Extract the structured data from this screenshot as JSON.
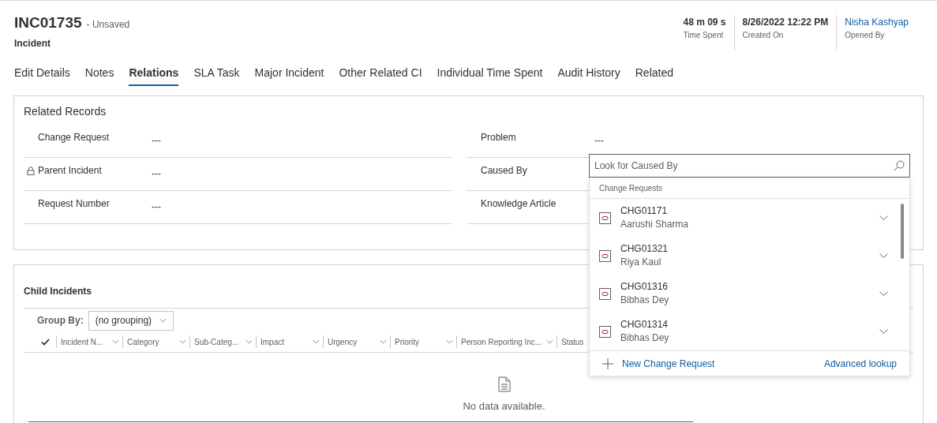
{
  "header": {
    "title": "INC01735",
    "save_status": "- Unsaved",
    "entity": "Incident",
    "stats": [
      {
        "value": "48 m 09 s",
        "label": "Time Spent",
        "kind": "text"
      },
      {
        "value": "8/26/2022 12:22 PM",
        "label": "Created On",
        "kind": "text"
      },
      {
        "value": "Nisha Kashyap",
        "label": "Opened By",
        "kind": "link"
      }
    ]
  },
  "tabs": [
    {
      "label": "Edit Details",
      "selected": false
    },
    {
      "label": "Notes",
      "selected": false
    },
    {
      "label": "Relations",
      "selected": true
    },
    {
      "label": "SLA Task",
      "selected": false
    },
    {
      "label": "Major Incident",
      "selected": false
    },
    {
      "label": "Other Related CI",
      "selected": false
    },
    {
      "label": "Individual Time Spent",
      "selected": false
    },
    {
      "label": "Audit History",
      "selected": false
    },
    {
      "label": "Related",
      "selected": false
    }
  ],
  "related_records": {
    "title": "Related Records",
    "left_fields": [
      {
        "label": "Change Request",
        "value": "---",
        "locked": false
      },
      {
        "label": "Parent Incident",
        "value": "---",
        "locked": true
      },
      {
        "label": "Request Number",
        "value": "---",
        "locked": false
      }
    ],
    "right_fields": [
      {
        "label": "Problem",
        "value": "---"
      },
      {
        "label": "Caused By"
      },
      {
        "label": "Knowledge Article"
      }
    ]
  },
  "child_incidents": {
    "title": "Child Incidents",
    "group_by_label": "Group By:",
    "group_by_value": "(no grouping)",
    "columns": [
      "Incident N...",
      "Category",
      "Sub-Categ...",
      "Impact",
      "Urgency",
      "Priority",
      "Person Reporting Inc...",
      "Status"
    ],
    "empty_message": "No data available."
  },
  "lookup": {
    "placeholder": "Look for Caused By",
    "section": "Change Requests",
    "items": [
      {
        "id": "CHG01171",
        "name": "Aarushi Sharma"
      },
      {
        "id": "CHG01321",
        "name": "Riya Kaul"
      },
      {
        "id": "CHG01316",
        "name": "Bibhas Dey"
      },
      {
        "id": "CHG01314",
        "name": "Bibhas Dey"
      }
    ],
    "new_action": "New Change Request",
    "advanced": "Advanced lookup"
  }
}
